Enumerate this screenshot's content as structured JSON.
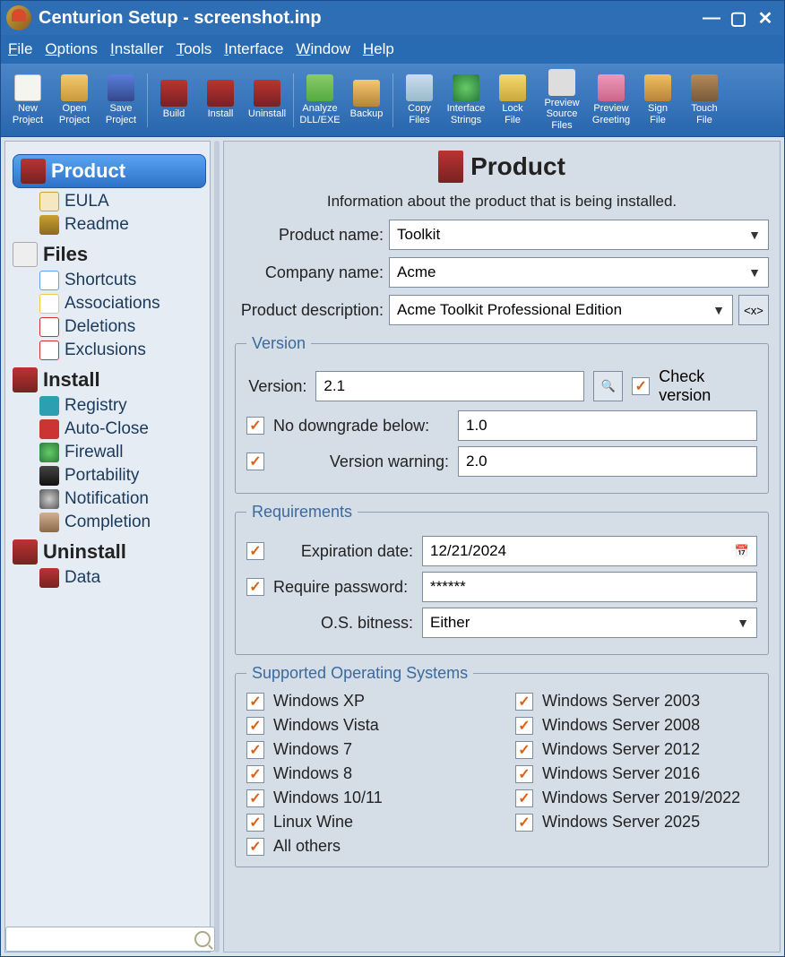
{
  "window": {
    "title": "Centurion Setup - screenshot.inp"
  },
  "menubar": [
    "File",
    "Options",
    "Installer",
    "Tools",
    "Interface",
    "Window",
    "Help"
  ],
  "toolbar": [
    {
      "label": "New\nProject",
      "icon": "ic-new"
    },
    {
      "label": "Open\nProject",
      "icon": "ic-open"
    },
    {
      "label": "Save\nProject",
      "icon": "ic-save"
    },
    {
      "sep": true
    },
    {
      "label": "Build",
      "icon": "ic-build"
    },
    {
      "label": "Install",
      "icon": "ic-install"
    },
    {
      "label": "Uninstall",
      "icon": "ic-uninstall"
    },
    {
      "sep": true
    },
    {
      "label": "Analyze\nDLL/EXE",
      "icon": "ic-analyze"
    },
    {
      "label": "Backup",
      "icon": "ic-backup"
    },
    {
      "sep": true
    },
    {
      "label": "Copy\nFiles",
      "icon": "ic-copy"
    },
    {
      "label": "Interface\nStrings",
      "icon": "ic-iface"
    },
    {
      "label": "Lock\nFile",
      "icon": "ic-lock"
    },
    {
      "label": "Preview\nSource Files",
      "icon": "ic-prevsrc",
      "wide": true
    },
    {
      "label": "Preview\nGreeting",
      "icon": "ic-prevgreet"
    },
    {
      "label": "Sign\nFile",
      "icon": "ic-sign"
    },
    {
      "label": "Touch\nFile",
      "icon": "ic-touch"
    }
  ],
  "sidebar": [
    {
      "title": "Product",
      "icon": "ic-product",
      "selected": true,
      "items": [
        {
          "label": "EULA",
          "icon": "ic-eula"
        },
        {
          "label": "Readme",
          "icon": "ic-readme"
        }
      ]
    },
    {
      "title": "Files",
      "icon": "ic-files",
      "items": [
        {
          "label": "Shortcuts",
          "icon": "ic-shortcuts"
        },
        {
          "label": "Associations",
          "icon": "ic-assoc"
        },
        {
          "label": "Deletions",
          "icon": "ic-del"
        },
        {
          "label": "Exclusions",
          "icon": "ic-excl"
        }
      ]
    },
    {
      "title": "Install",
      "icon": "ic-install2",
      "items": [
        {
          "label": "Registry",
          "icon": "ic-registry"
        },
        {
          "label": "Auto-Close",
          "icon": "ic-autoclose"
        },
        {
          "label": "Firewall",
          "icon": "ic-firewall"
        },
        {
          "label": "Portability",
          "icon": "ic-port"
        },
        {
          "label": "Notification",
          "icon": "ic-notif"
        },
        {
          "label": "Completion",
          "icon": "ic-complete"
        }
      ]
    },
    {
      "title": "Uninstall",
      "icon": "ic-uninstall2",
      "items": [
        {
          "label": "Data",
          "icon": "ic-data"
        }
      ]
    }
  ],
  "page": {
    "title": "Product",
    "subtitle": "Information about the product that is being installed.",
    "labels": {
      "product_name": "Product name:",
      "company_name": "Company name:",
      "product_desc": "Product description:",
      "version_legend": "Version",
      "version": "Version:",
      "check_version": "Check version",
      "no_downgrade": "No downgrade below:",
      "version_warning": "Version warning:",
      "req_legend": "Requirements",
      "expiration": "Expiration date:",
      "require_pw": "Require password:",
      "os_bitness": "O.S. bitness:",
      "os_legend": "Supported Operating Systems"
    },
    "values": {
      "product_name": "Toolkit",
      "company_name": "Acme",
      "product_desc": "Acme Toolkit Professional Edition",
      "version": "2.1",
      "no_downgrade": "1.0",
      "version_warning": "2.0",
      "expiration": "12/21/2024",
      "password": "******",
      "os_bitness": "Either"
    },
    "os_left": [
      "Windows XP",
      "Windows Vista",
      "Windows 7",
      "Windows 8",
      "Windows 10/11",
      "Linux Wine",
      "All others"
    ],
    "os_right": [
      "Windows Server 2003",
      "Windows Server 2008",
      "Windows Server 2012",
      "Windows Server 2016",
      "Windows Server 2019/2022",
      "Windows Server 2025"
    ]
  }
}
